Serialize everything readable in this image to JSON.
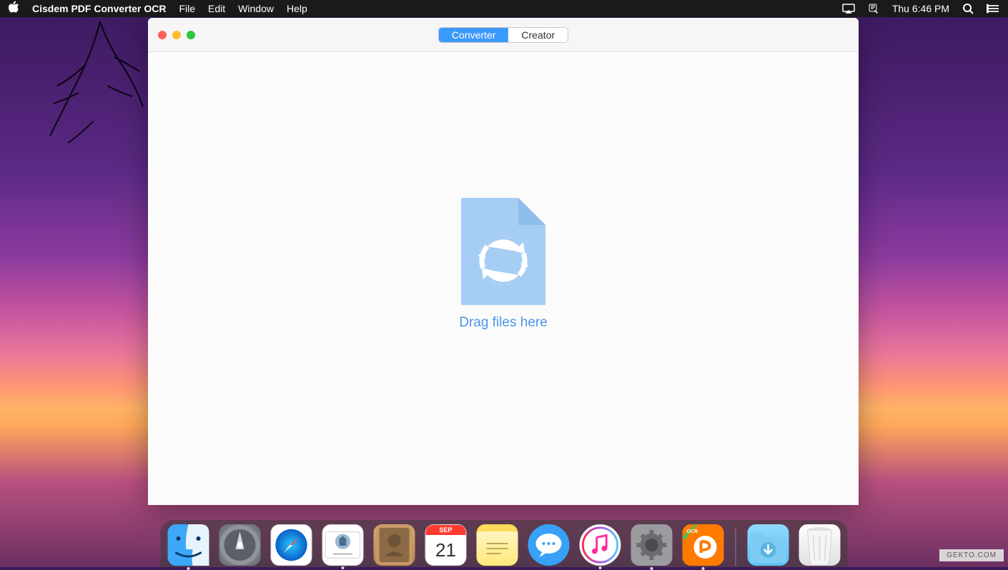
{
  "menubar": {
    "app_name": "Cisdem PDF Converter OCR",
    "items": [
      "File",
      "Edit",
      "Window",
      "Help"
    ],
    "clock": "Thu 6:46 PM"
  },
  "window": {
    "tabs": {
      "converter": "Converter",
      "creator": "Creator"
    },
    "drop_text": "Drag files here"
  },
  "dock": {
    "calendar_month": "SEP",
    "calendar_day": "21",
    "items": [
      {
        "name": "finder",
        "running": true
      },
      {
        "name": "launchpad",
        "running": false
      },
      {
        "name": "safari",
        "running": false
      },
      {
        "name": "mail",
        "running": true
      },
      {
        "name": "contacts",
        "running": false
      },
      {
        "name": "calendar",
        "running": false
      },
      {
        "name": "notes",
        "running": false
      },
      {
        "name": "messages",
        "running": false
      },
      {
        "name": "itunes",
        "running": true
      },
      {
        "name": "settings",
        "running": true
      },
      {
        "name": "cisdem",
        "running": true
      }
    ]
  },
  "watermark": "GEKTO.COM"
}
